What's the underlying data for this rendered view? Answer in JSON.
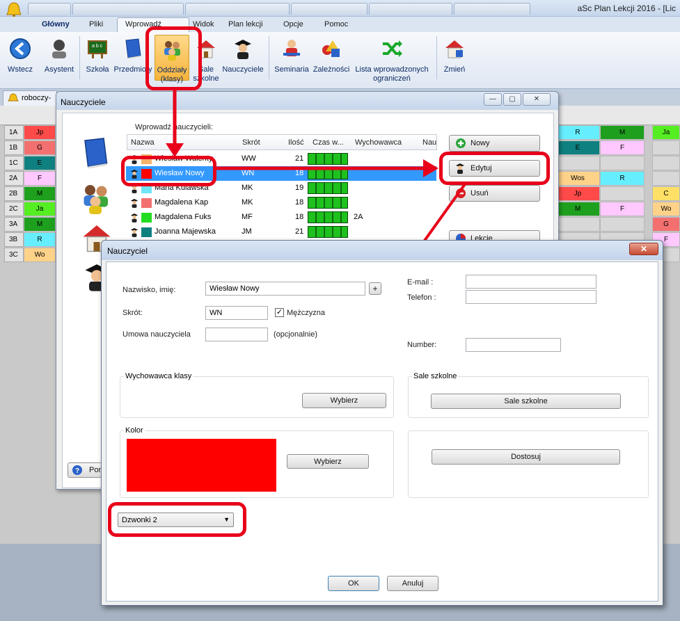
{
  "titlebar": {
    "app_title": "aSc Plan Lekcji 2016  - [Lic"
  },
  "menu": [
    "Główny",
    "Pliki",
    "Wprowadź",
    "Widok",
    "Plan lekcji",
    "Opcje",
    "Pomoc"
  ],
  "ribbon": [
    {
      "label": "Wstecz"
    },
    {
      "label": "Asystent"
    },
    {
      "label": "Szkoła"
    },
    {
      "label": "Przedmioty"
    },
    {
      "label": "Oddziały\n(klasy)"
    },
    {
      "label": "Sale\nszkolne"
    },
    {
      "label": "Nauczyciele"
    },
    {
      "label": "Seminaria"
    },
    {
      "label": "Zależności"
    },
    {
      "label": "Lista wprowadzonych\nograniczeń"
    },
    {
      "label": "Zmień"
    }
  ],
  "doc_tab": "roboczy-",
  "timetable": {
    "rows": [
      "1A",
      "1B",
      "1C",
      "2A",
      "2B",
      "2C",
      "3A",
      "3B",
      "3C"
    ],
    "left_cells": [
      "Jp",
      "G",
      "E",
      "F",
      "M",
      "Ja",
      "M",
      "R",
      "Wo"
    ],
    "right_cells": [
      [
        "R",
        "M",
        "Ja"
      ],
      [
        "E",
        "F",
        ""
      ],
      [
        "",
        "",
        ""
      ],
      [
        "Wos",
        "R",
        ""
      ],
      [
        "Jp",
        "",
        "C"
      ],
      [
        "M",
        "F",
        "Wo"
      ],
      [
        "",
        "",
        "G"
      ],
      [
        "",
        "",
        "F"
      ],
      [
        "",
        "",
        ""
      ]
    ]
  },
  "teachers_window": {
    "title": "Nauczyciele",
    "list_label": "Wprowadź nauczycieli:",
    "columns": [
      "Nazwa",
      "Skrót",
      "Ilość",
      "Czas w...",
      "Wychowawca",
      "Nau"
    ],
    "rows": [
      {
        "name": "Wiesław Walenty",
        "abbr": "WW",
        "count": "21",
        "homeroom": "",
        "color": "#f6b26b"
      },
      {
        "name": "Wiesław Nowy",
        "abbr": "WN",
        "count": "18",
        "homeroom": "",
        "color": "#ff0000"
      },
      {
        "name": "Maria Kulawska",
        "abbr": "MK",
        "count": "19",
        "homeroom": "",
        "color": "#6fe5f7"
      },
      {
        "name": "Magdalena Kap",
        "abbr": "MK",
        "count": "18",
        "homeroom": "",
        "color": "#f47070"
      },
      {
        "name": "Magdalena Fuks",
        "abbr": "MF",
        "count": "18",
        "homeroom": "2A",
        "color": "#22dd22"
      },
      {
        "name": "Joanna Majewska",
        "abbr": "JM",
        "count": "21",
        "homeroom": "",
        "color": "#0f8080"
      }
    ],
    "buttons": {
      "new": "Nowy",
      "edit": "Edytuj",
      "delete": "Usuń",
      "lessons": "Lekcje",
      "help": "Pomoc"
    }
  },
  "teacher_dialog": {
    "title": "Nauczyciel",
    "close": "✕",
    "name_label": "Nazwisko, imię:",
    "name_value": "Wiesław Nowy",
    "plus": "+",
    "abbr_label": "Skrót:",
    "abbr_value": "WN",
    "male_label": "Mężczyzna",
    "male_mark": "✓",
    "contract_label": "Umowa nauczyciela",
    "contract_value": "",
    "optional": "(opcjonalnie)",
    "email_label": "E-mail :",
    "phone_label": "Telefon :",
    "number_label": "Number:",
    "homeroom_group": "Wychowawca klasy",
    "choose": "Wybierz",
    "rooms_group": "Sale szkolne",
    "rooms_button": "Sale szkolne",
    "color_group": "Kolor",
    "color_value": "#ff0000",
    "customize": "Dostosuj",
    "bells": "Dzwonki 2",
    "ok": "OK",
    "cancel": "Anuluj"
  },
  "colors": {
    "highlight": "#e8001a",
    "selected_row": "#3399ff"
  }
}
